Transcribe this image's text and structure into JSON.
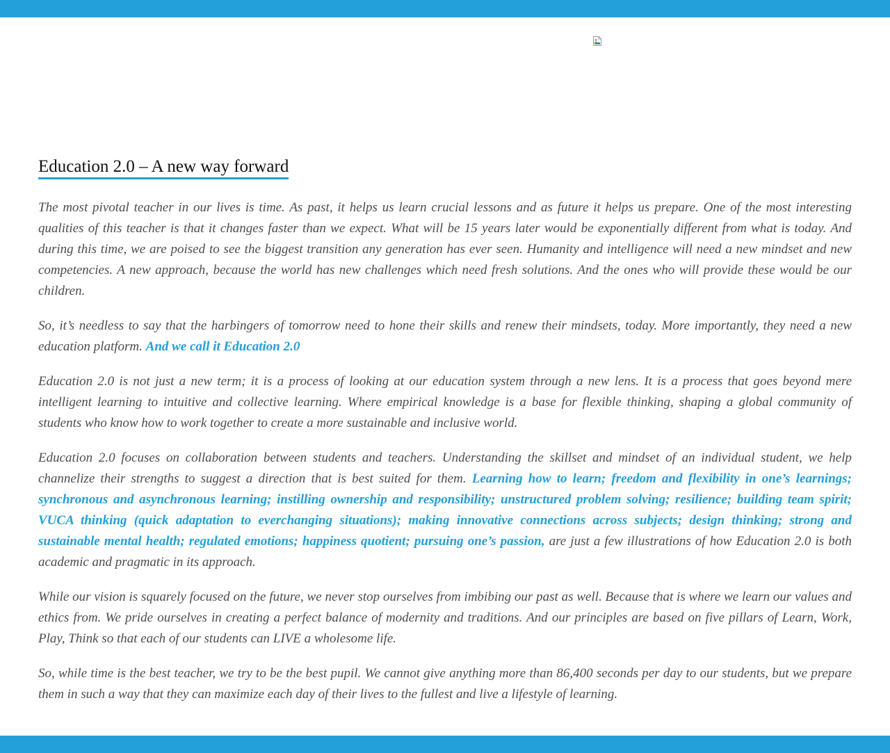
{
  "page": {
    "accent_color": "#239fd9",
    "header_image_icon": "broken-image-icon"
  },
  "article": {
    "title": "Education 2.0 – A new way forward",
    "p1": "The most pivotal teacher in our lives is time. As past, it helps us learn crucial lessons and as future it helps us prepare. One of the most interesting qualities of this teacher is that it changes faster than we expect. What will be 15 years later would be exponentially different from what is today. And during this time, we are poised to see the biggest transition any generation has ever seen. Humanity and intelligence will need a new mindset and new competencies. A new approach, because the world has new challenges which need fresh solutions. And the ones who will provide these would be our children.",
    "p2_text": "So, it’s needless to say that the harbingers of tomorrow need to hone their skills and renew their mindsets, today. More importantly, they need a new education platform. ",
    "p2_highlight": "And we call it Education 2.0",
    "p3": "Education 2.0 is not just a new term; it is a process of looking at our education system through a new lens. It is a process that goes beyond mere intelligent learning to intuitive and collective learning. Where empirical knowledge is a base for flexible thinking, shaping a global community of students who know how to work together to create a more sustainable and inclusive world.",
    "p4_text_before": "Education 2.0 focuses on collaboration between students and teachers. Understanding the skillset and mindset of an individual student, we help channelize their strengths to suggest a direction that is best suited for them. ",
    "p4_highlight": "Learning how to learn; freedom and flexibility in one’s learnings; synchronous and asynchronous learning; instilling ownership and responsibility; unstructured problem solving; resilience; building team spirit; VUCA thinking (quick adaptation to everchanging situations); making innovative connections across subjects; design thinking; strong and sustainable mental health; regulated emotions; happiness quotient; pursuing one’s passion,",
    "p4_text_after": " are just a few illustrations of how Education 2.0 is both academic and pragmatic in its approach.",
    "p5": "While our vision is squarely focused on the future, we never stop ourselves from imbibing our past as well. Because that is where we learn our values and ethics from. We pride ourselves in creating a perfect balance of modernity and traditions. And our principles are based on five pillars of Learn, Work, Play, Think so that each of our students can LIVE a wholesome life.",
    "p6": "So, while time is the best teacher, we try to be the best pupil. We cannot give anything more than 86,400 seconds per day to our students, but we prepare them in such a way that they can maximize each day of their lives to the fullest and live a lifestyle of learning."
  }
}
